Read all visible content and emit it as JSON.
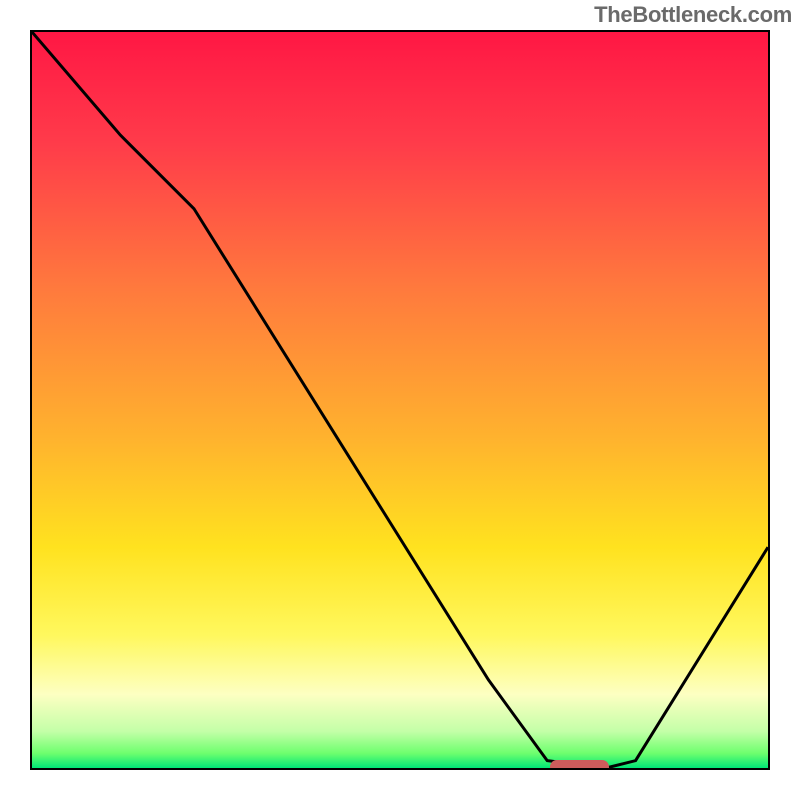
{
  "watermark": "TheBottleneck.com",
  "chart_data": {
    "type": "line",
    "title": "",
    "xlabel": "",
    "ylabel": "",
    "xlim": [
      0,
      100
    ],
    "ylim": [
      0,
      100
    ],
    "gradient_stops": [
      {
        "offset": 0,
        "color": "#ff1744"
      },
      {
        "offset": 15,
        "color": "#ff3b4a"
      },
      {
        "offset": 35,
        "color": "#ff7a3d"
      },
      {
        "offset": 55,
        "color": "#ffb22e"
      },
      {
        "offset": 70,
        "color": "#ffe21f"
      },
      {
        "offset": 82,
        "color": "#fff85e"
      },
      {
        "offset": 90,
        "color": "#fdffc2"
      },
      {
        "offset": 95,
        "color": "#c4ffa8"
      },
      {
        "offset": 98,
        "color": "#6eff6e"
      },
      {
        "offset": 100,
        "color": "#00e676"
      }
    ],
    "series": [
      {
        "name": "bottleneck-curve",
        "x": [
          0,
          12,
          22,
          42,
          62,
          70,
          78,
          82,
          100
        ],
        "y": [
          100,
          86,
          76,
          44,
          12,
          1,
          0,
          1,
          30
        ]
      }
    ],
    "marker": {
      "x_start": 70,
      "x_end": 78,
      "y": 0,
      "color": "#cd5c5c"
    }
  }
}
